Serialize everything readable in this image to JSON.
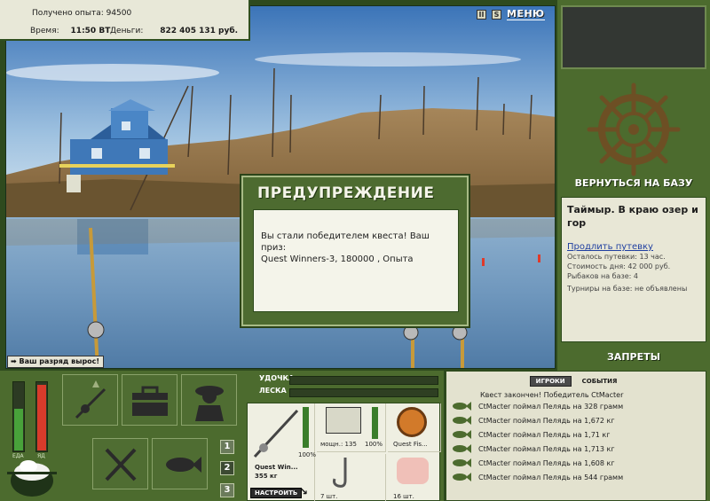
{
  "header": {
    "experience": "Получено опыта: 94500",
    "time_label": "Время:",
    "time_value": "11:50 ВТ",
    "money_label": "Деньги:",
    "money_value": "822 405 131 руб.",
    "pause_glyph": "II",
    "sound_glyph": "S",
    "menu_label": "МЕНЮ"
  },
  "dialog": {
    "title": "ПРЕДУПРЕЖДЕНИЕ",
    "message_line1": "Вы стали победителем квеста! Ваш приз:",
    "message_line2": "Quest Winners-3, 180000 , Опыта"
  },
  "rank_notice": "Ваш разряд вырос!",
  "right": {
    "return_label": "ВЕРНУТЬСЯ НА БАЗУ",
    "location_title": "Таймыр. В краю озер и гор",
    "extend_link": "Продлить путевку",
    "remaining": "Осталось путевки: 13 час.",
    "day_cost": "Стоимость дня: 42 000 руб.",
    "anglers": "Рыбаков на базе: 4",
    "tournaments": "Турниры на базе: не объявлены",
    "bans_label": "ЗАПРЕТЫ"
  },
  "status_bars": {
    "food_label": "ЕДА",
    "food_level": 0.6,
    "poison_label": "ЯД",
    "poison_level": 0.95
  },
  "meters": {
    "rod_label": "УДОЧКА",
    "line_label": "ЛЕСКА"
  },
  "gear": {
    "rod_name": "Quest Win...",
    "rod_weight": "355 кг",
    "rod_condition": "100%",
    "reel_info": "мощн.: 135",
    "reel_condition": "100%",
    "line_name": "Quest Fis...",
    "hook_count": "7 шт.",
    "bait_count": "16 шт.",
    "tune_label": "НАСТРОИТЬ"
  },
  "slots": {
    "n1": "1",
    "n2": "2",
    "n3": "3"
  },
  "events": {
    "tab_players": "ИГРОКИ",
    "tab_events": "СОБЫТИЯ",
    "winner": "Квест закончен! Победитель CtMacter",
    "items": [
      "CtMacter поймал Пелядь на 328 грамм",
      "CtMacter поймал Пелядь на 1,672 кг",
      "CtMacter поймал Пелядь на 1,71 кг",
      "CtMacter поймал Пелядь на 1,713 кг",
      "CtMacter поймал Пелядь на 1,608 кг",
      "CtMacter поймал Пелядь на 544 грамм"
    ]
  },
  "colors": {
    "panel_green": "#4c6b2e",
    "panel_cream": "#e8e7d6",
    "food_bar": "#48a23a",
    "poison_bar": "#d83b2b"
  }
}
